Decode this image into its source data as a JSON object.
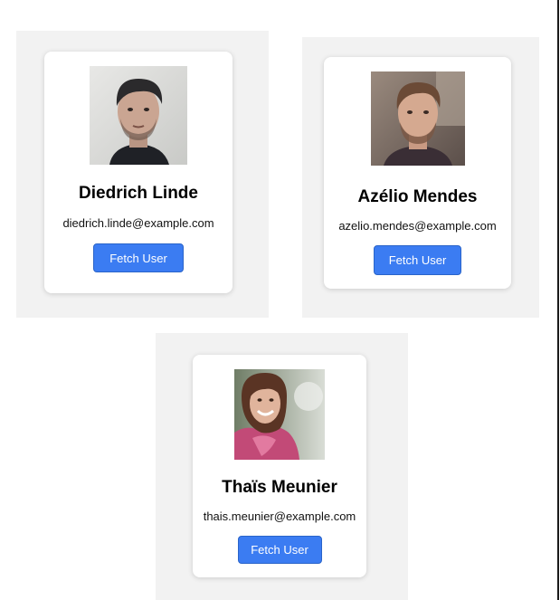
{
  "users": [
    {
      "name": "Diedrich Linde",
      "email": "diedrich.linde@example.com",
      "button_label": "Fetch User"
    },
    {
      "name": "Azélio Mendes",
      "email": "azelio.mendes@example.com",
      "button_label": "Fetch User"
    },
    {
      "name": "Thaïs Meunier",
      "email": "thais.meunier@example.com",
      "button_label": "Fetch User"
    }
  ],
  "colors": {
    "page_background": "#ffffff",
    "panel_background": "#f2f2f2",
    "card_background": "#ffffff",
    "button_background": "#3b7cf2",
    "button_text": "#ffffff"
  }
}
